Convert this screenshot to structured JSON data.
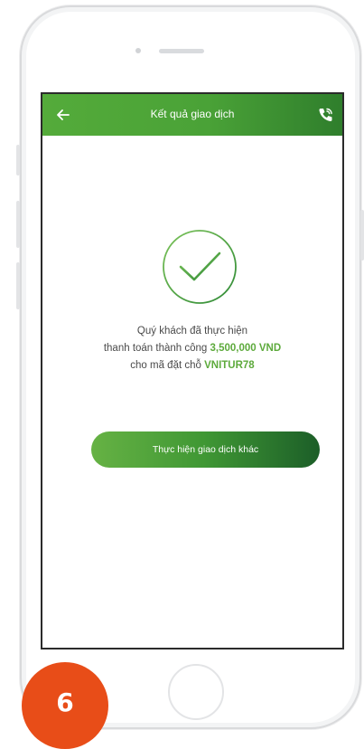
{
  "header": {
    "title": "Kết quả giao dịch",
    "back_icon": "arrow-left-icon",
    "call_icon": "phone-icon",
    "color_start": "#54ab3a",
    "color_end": "#2f7e2c"
  },
  "result": {
    "icon": "checkmark-circle-icon",
    "line1": "Quý khách đã thực hiện",
    "line2_prefix": "thanh toán thành công",
    "amount": "3,500,000 VND",
    "line3_prefix": "cho mã đặt chỗ",
    "booking_code": "VNITUR78",
    "highlight_color": "#5daa3c"
  },
  "action_button": {
    "label": "Thực hiện giao dịch khác"
  },
  "step_badge": {
    "number": "6",
    "color": "#e84d18"
  }
}
